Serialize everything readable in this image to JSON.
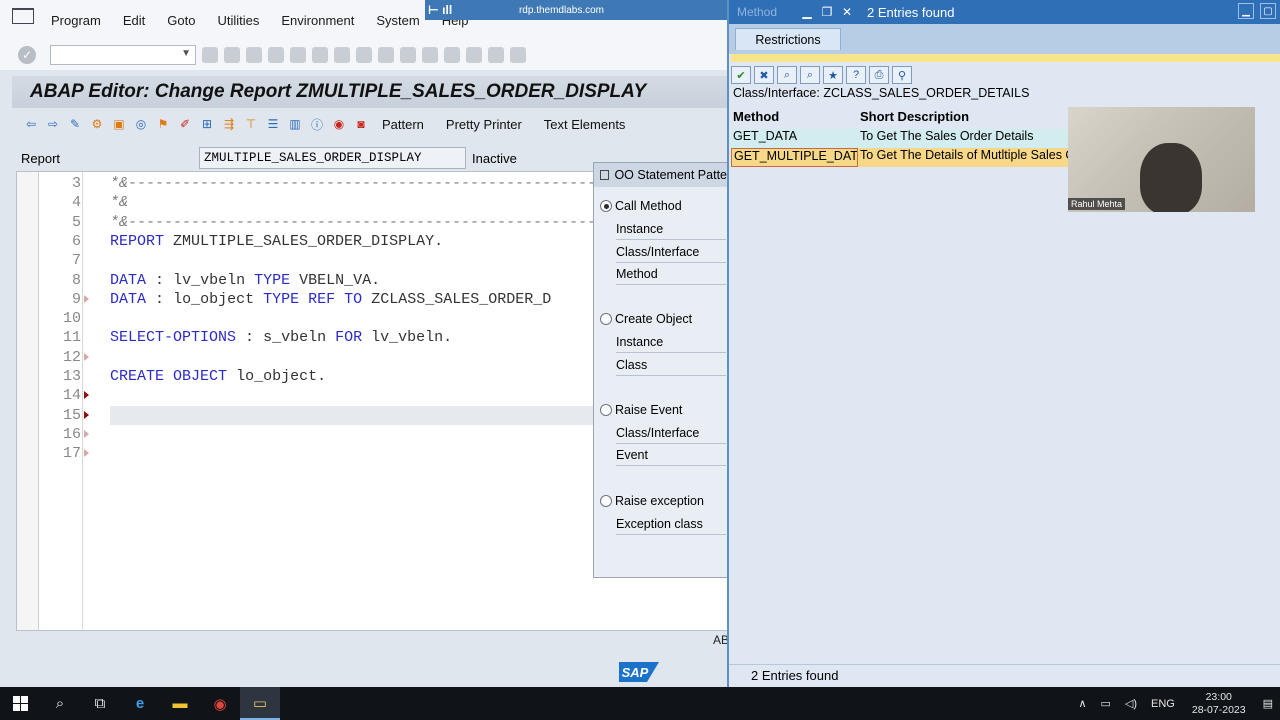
{
  "rdp": {
    "host": "rdp.themdlabs.com"
  },
  "menu": [
    "Program",
    "Edit",
    "Goto",
    "Utilities",
    "Environment",
    "System",
    "Help"
  ],
  "editor_title": "ABAP Editor: Change Report ZMULTIPLE_SALES_ORDER_DISPLAY",
  "app_toolbar": {
    "pattern": "Pattern",
    "pretty_printer": "Pretty Printer",
    "text_elements": "Text Elements"
  },
  "report": {
    "label": "Report",
    "name": "ZMULTIPLE_SALES_ORDER_DISPLAY",
    "status": "Inactive"
  },
  "code_lines": [
    {
      "n": "3",
      "text": "*&---------------------------------------------------------------"
    },
    {
      "n": "4",
      "text": "*&"
    },
    {
      "n": "5",
      "text": "*&---------------------------------------------------------------"
    },
    {
      "n": "6",
      "text": "REPORT ZMULTIPLE_SALES_ORDER_DISPLAY."
    },
    {
      "n": "7",
      "text": ""
    },
    {
      "n": "8",
      "text": "DATA : lv_vbeln TYPE VBELN_VA."
    },
    {
      "n": "9",
      "text": "DATA : lo_object TYPE REF TO ZCLASS_SALES_ORDER_D"
    },
    {
      "n": "10",
      "text": ""
    },
    {
      "n": "11",
      "text": "SELECT-OPTIONS : s_vbeln FOR lv_vbeln."
    },
    {
      "n": "12",
      "text": ""
    },
    {
      "n": "13",
      "text": "CREATE OBJECT lo_object."
    },
    {
      "n": "14",
      "text": ""
    },
    {
      "n": "15",
      "text": ""
    },
    {
      "n": "16",
      "text": ""
    },
    {
      "n": "17",
      "text": ""
    }
  ],
  "oo_dialog": {
    "title": "OO Statement Patte",
    "call_method": "Call Method",
    "instance": "Instance",
    "class_interface": "Class/Interface",
    "method": "Method",
    "create_object": "Create Object",
    "instance2": "Instance",
    "class": "Class",
    "raise_event": "Raise Event",
    "class_interface2": "Class/Interface",
    "event": "Event",
    "raise_exception": "Raise exception",
    "exception_class": "Exception class"
  },
  "status_fragment": "AB",
  "sap_logo": "SAP",
  "f4": {
    "ghost_title": "Method",
    "title": "2 Entries found",
    "tab": "Restrictions",
    "class_interface": "Class/Interface: ZCLASS_SALES_ORDER_DETAILS",
    "columns": [
      "Method",
      "Short Description"
    ],
    "rows": [
      {
        "method": "GET_DATA",
        "desc": "To Get The Sales Order Details"
      },
      {
        "method": "GET_MULTIPLE_DATA",
        "desc": "To Get The Details of Mutltiple Sales O"
      }
    ],
    "webcam_name": "Rahul Mehta",
    "footer": "2 Entries found"
  },
  "taskbar": {
    "lang": "ENG",
    "time": "23:00",
    "date": "28-07-2023"
  }
}
